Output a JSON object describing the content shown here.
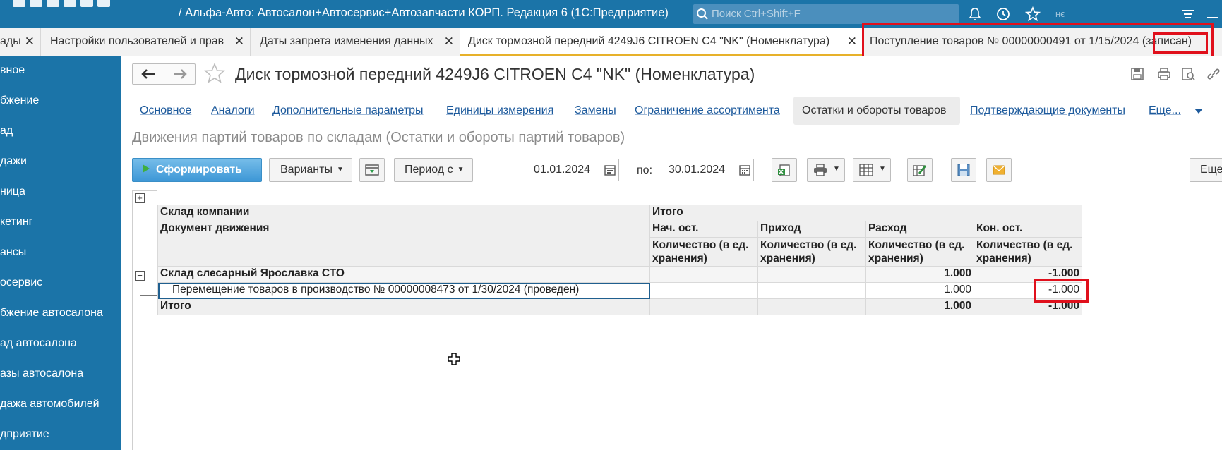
{
  "titlebar": {
    "title": "/ Альфа-Авто: Автосалон+Автосервис+Автозапчасти КОРП. Редакция 6  (1С:Предприятие)",
    "search_placeholder": "Поиск Ctrl+Shift+F",
    "faint_right": "нє"
  },
  "tabs": [
    {
      "label": "ады"
    },
    {
      "label": "Настройки пользователей и прав"
    },
    {
      "label": "Даты запрета изменения данных"
    },
    {
      "label": "Диск тормозной передний 4249J6 CITROEN C4 \"NK\" (Номенклатура)"
    },
    {
      "label": "Поступление товаров № 00000000491 от 1/15/2024 (записан)"
    }
  ],
  "sidebar": {
    "items": [
      {
        "label": "вное"
      },
      {
        "label": "бжение"
      },
      {
        "label": "ад"
      },
      {
        "label": "дажи"
      },
      {
        "label": "ница"
      },
      {
        "label": "кетинг"
      },
      {
        "label": "ансы"
      },
      {
        "label": "осервис"
      },
      {
        "label": "бжение автосалона"
      },
      {
        "label": "ад автосалона"
      },
      {
        "label": "азы автосалона"
      },
      {
        "label": "дажа автомобилей"
      },
      {
        "label": "дприятие"
      }
    ]
  },
  "document": {
    "title": "Диск тормозной передний 4249J6 CITROEN C4 \"NK\" (Номенклатура)"
  },
  "links": [
    {
      "label": "Основное"
    },
    {
      "label": "Аналоги"
    },
    {
      "label": "Дополнительные параметры"
    },
    {
      "label": "Единицы измерения"
    },
    {
      "label": "Замены"
    },
    {
      "label": "Ограничение ассортимента"
    },
    {
      "label": "Остатки и обороты товаров"
    },
    {
      "label": "Подтверждающие документы"
    },
    {
      "label": "Еще..."
    }
  ],
  "report": {
    "title": "Движения партий товаров по складам (Остатки и обороты партий товаров)"
  },
  "toolbar": {
    "generate": "Сформировать",
    "variants": "Варианты",
    "period": "Период с",
    "date_from": "01.01.2024",
    "po_label": "по:",
    "date_to": "30.01.2024",
    "more": "Еще"
  },
  "table": {
    "h_warehouse": "Склад компании",
    "h_total": "Итого",
    "h_doc": "Документ движения",
    "h_start": "Нач. ост.",
    "h_in": "Приход",
    "h_out": "Расход",
    "h_end": "Кон. ост.",
    "h_qty": "Количество (в ед. хранения)",
    "group_name": "Склад слесарный Ярославка СТО",
    "group_out": "1.000",
    "group_end": "-1.000",
    "row_doc": "Перемещение товаров в производство № 00000008473 от 1/30/2024 (проведен)",
    "row_out": "1.000",
    "row_end": "-1.000",
    "total_label": "Итого",
    "total_out": "1.000",
    "total_end": "-1.000"
  }
}
